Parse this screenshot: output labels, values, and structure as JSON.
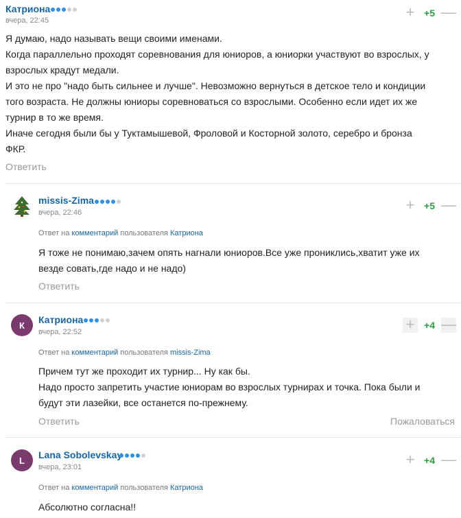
{
  "comments": [
    {
      "author": "Катриона",
      "time": "вчера, 22:45",
      "score": "+5",
      "lines": [
        "Я думаю, надо называть вещи своими именами.",
        "Когда параллельно проходят соревнования для юниоров, а юниорки участвуют во взрослых, у",
        "взрослых крадут медали.",
        "И это не про \"надо быть сильнее и лучше\". Невозможно вернуться в детское тело и кондиции",
        "того возраста. Не должны юниоры соревноваться со взрослыми. Особенно если идет их же",
        "турнир в то же время.",
        "Иначе сегодня были бы у Туктамышевой, Фроловой и Косторной золото, серебро и бронза",
        "ФКР."
      ],
      "reply": "Ответить"
    },
    {
      "author": "missis-Zima",
      "time": "вчера, 22:46",
      "score": "+5",
      "meta": {
        "a": "Ответ на ",
        "link1": "комментарий",
        "b": " пользователя ",
        "user": "Катриона"
      },
      "lines": [
        "Я тоже не понимаю,зачем опять нагнали юниоров.Все уже прониклись,хватит уже их",
        "везде совать,где надо и не надо)"
      ],
      "reply": "Ответить"
    },
    {
      "author": "Катриона",
      "avatar_letter": "К",
      "time": "вчера, 22:52",
      "score": "+4",
      "meta": {
        "a": "Ответ на ",
        "link1": "комментарий",
        "b": " пользователя ",
        "user": "missis-Zima"
      },
      "lines": [
        "Причем тут же проходит их турнир... Ну как бы.",
        "Надо просто запретить участие юниорам во взрослых турнирах и точка. Пока были и",
        "будут эти лазейки, все останется по-прежнему."
      ],
      "reply": "Ответить",
      "report": "Пожаловаться"
    },
    {
      "author": "Lana Sobolevskay",
      "avatar_letter": "L",
      "time": "вчера, 23:01",
      "score": "+4",
      "meta": {
        "a": "Ответ на ",
        "link1": "комментарий",
        "b": " пользователя ",
        "user": "Катриона"
      },
      "lines": [
        "Абсолютно согласна!!"
      ]
    }
  ],
  "icons": {
    "plus": "plus-icon",
    "minus": "minus-icon",
    "tree": "christmas-tree-icon"
  },
  "colors": {
    "author": "#1565a9",
    "score": "#27a23a",
    "avatar": "#7b3a6e",
    "rating_dot": "#2e8fe6"
  }
}
